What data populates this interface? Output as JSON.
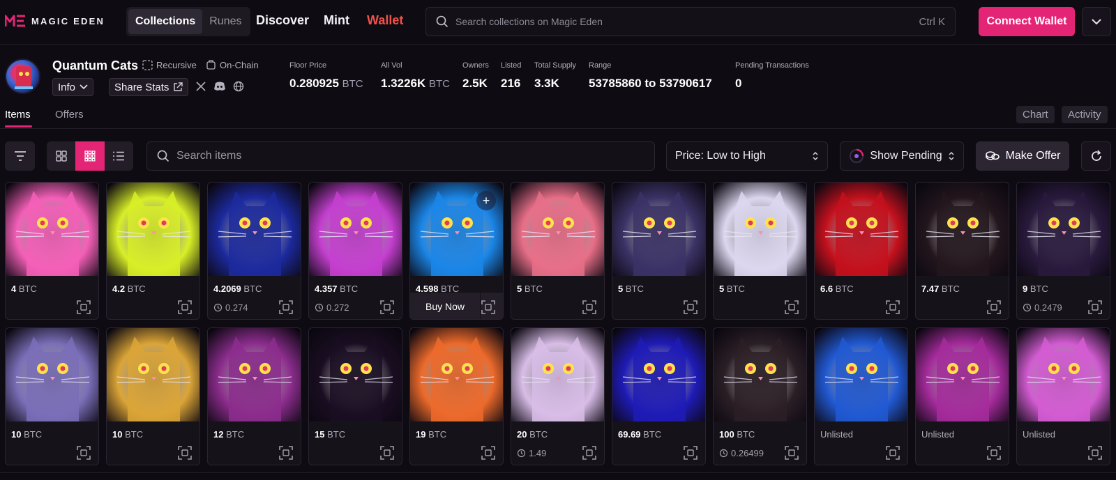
{
  "brand": {
    "name": "MAGIC EDEN"
  },
  "header": {
    "segments": [
      {
        "label": "Collections",
        "active": true
      },
      {
        "label": "Runes",
        "active": false
      }
    ],
    "nav": {
      "discover": "Discover",
      "mint": "Mint",
      "wallet": "Wallet"
    },
    "wallet_color": "#f0524b",
    "search_placeholder": "Search collections on Magic Eden",
    "search_shortcut": "Ctrl K",
    "connect_label": "Connect Wallet",
    "accent": "#e42575"
  },
  "collection": {
    "name": "Quantum Cats",
    "tags": [
      "Recursive",
      "On-Chain"
    ],
    "info_label": "Info",
    "share_label": "Share Stats",
    "stats": [
      {
        "label": "Floor Price",
        "value": "0.280925",
        "unit": "BTC"
      },
      {
        "label": "All Vol",
        "value": "1.3226K",
        "unit": "BTC"
      },
      {
        "label": "Owners",
        "value": "2.5K",
        "unit": ""
      },
      {
        "label": "Listed",
        "value": "216",
        "unit": ""
      },
      {
        "label": "Total Supply",
        "value": "3.3K",
        "unit": ""
      },
      {
        "label": "Range",
        "value": "53785860 to 53790617",
        "unit": ""
      },
      {
        "label": "Pending Transactions",
        "value": "0",
        "unit": ""
      }
    ]
  },
  "tabs": {
    "items": "Items",
    "offers": "Offers",
    "chart": "Chart",
    "activity": "Activity"
  },
  "toolbar": {
    "search_placeholder": "Search items",
    "sort_label": "Price: Low to High",
    "pending_label": "Show Pending",
    "offer_label": "Make Offer"
  },
  "items": [
    {
      "price": "4",
      "unit": "BTC",
      "sub": "",
      "theme": "#f45fb7"
    },
    {
      "price": "4.2",
      "unit": "BTC",
      "sub": "",
      "theme": "#d8ef27"
    },
    {
      "price": "4.2069",
      "unit": "BTC",
      "sub": "0.274",
      "theme": "#1c2a9e"
    },
    {
      "price": "4.357",
      "unit": "BTC",
      "sub": "0.272",
      "theme": "#c43fcf"
    },
    {
      "price": "4.598",
      "unit": "BTC",
      "sub": "",
      "theme": "#1b86e7",
      "buy": "Buy Now"
    },
    {
      "price": "5",
      "unit": "BTC",
      "sub": "",
      "theme": "#e86f88"
    },
    {
      "price": "5",
      "unit": "BTC",
      "sub": "",
      "theme": "#3b3366"
    },
    {
      "price": "5",
      "unit": "BTC",
      "sub": "",
      "theme": "#dcd7ef"
    },
    {
      "price": "6.6",
      "unit": "BTC",
      "sub": "",
      "theme": "#c4111d"
    },
    {
      "price": "7.47",
      "unit": "BTC",
      "sub": "",
      "theme": "#23161d"
    },
    {
      "price": "9",
      "unit": "BTC",
      "sub": "0.2479",
      "theme": "#291a3d"
    },
    {
      "price": "10",
      "unit": "BTC",
      "sub": "",
      "theme": "#7a6fb8"
    },
    {
      "price": "10",
      "unit": "BTC",
      "sub": "",
      "theme": "#dba537"
    },
    {
      "price": "12",
      "unit": "BTC",
      "sub": "",
      "theme": "#8c2d8d"
    },
    {
      "price": "15",
      "unit": "BTC",
      "sub": "",
      "theme": "#1a0e22"
    },
    {
      "price": "19",
      "unit": "BTC",
      "sub": "",
      "theme": "#ec6a2b"
    },
    {
      "price": "20",
      "unit": "BTC",
      "sub": "1.49",
      "theme": "#d8bde7"
    },
    {
      "price": "69.69",
      "unit": "BTC",
      "sub": "",
      "theme": "#1f1bb6"
    },
    {
      "price": "100",
      "unit": "BTC",
      "sub": "0.26499",
      "theme": "#2b1f26"
    },
    {
      "price": "Unlisted",
      "unit": "",
      "sub": "",
      "theme": "#2159d2"
    },
    {
      "price": "Unlisted",
      "unit": "",
      "sub": "",
      "theme": "#a42b9b"
    },
    {
      "price": "Unlisted",
      "unit": "",
      "sub": "",
      "theme": "#d35cd2"
    }
  ]
}
